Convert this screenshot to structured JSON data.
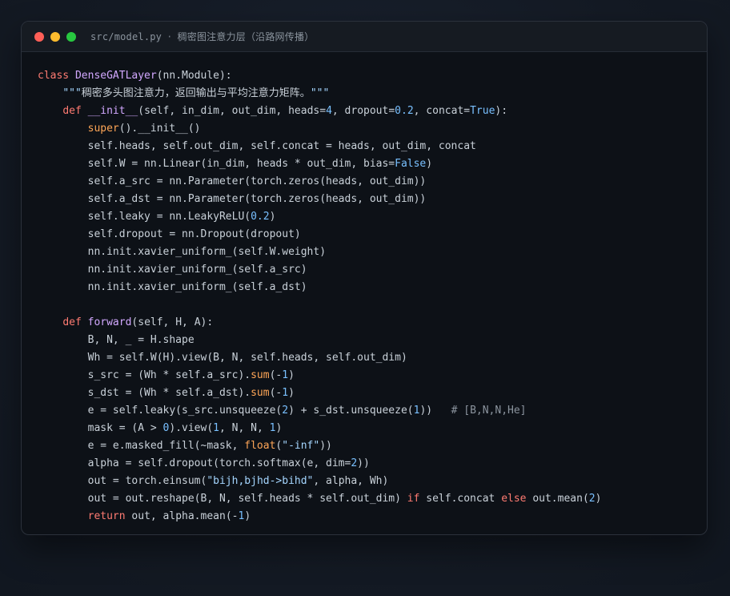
{
  "window": {
    "title_path": "src/model.py",
    "title_separator": "·",
    "title_desc": "稠密图注意力层（沿路网传播）"
  },
  "code": {
    "language": "python",
    "lines": [
      [
        [
          "kw",
          "class "
        ],
        [
          "fn",
          "DenseGATLayer"
        ],
        [
          "p",
          "(nn.Module):"
        ]
      ],
      [
        [
          "p",
          "    "
        ],
        [
          "doc",
          "\"\"\""
        ],
        [
          "p",
          "稠密多头图注意力，返回输出与平均注意力矩阵。"
        ],
        [
          "doc",
          "\"\"\""
        ]
      ],
      [
        [
          "p",
          "    "
        ],
        [
          "kw",
          "def "
        ],
        [
          "fn",
          "__init__"
        ],
        [
          "p",
          "(self, in_dim, out_dim, heads="
        ],
        [
          "num",
          "4"
        ],
        [
          "p",
          ", dropout="
        ],
        [
          "num",
          "0.2"
        ],
        [
          "p",
          ", concat="
        ],
        [
          "const",
          "True"
        ],
        [
          "p",
          "):"
        ]
      ],
      [
        [
          "p",
          "        "
        ],
        [
          "builtin",
          "super"
        ],
        [
          "p",
          "().__init__()"
        ]
      ],
      [
        [
          "p",
          "        self.heads, self.out_dim, self.concat = heads, out_dim, concat"
        ]
      ],
      [
        [
          "p",
          "        self.W = nn.Linear(in_dim, heads * out_dim, bias="
        ],
        [
          "const",
          "False"
        ],
        [
          "p",
          ")"
        ]
      ],
      [
        [
          "p",
          "        self.a_src = nn.Parameter(torch.zeros(heads, out_dim))"
        ]
      ],
      [
        [
          "p",
          "        self.a_dst = nn.Parameter(torch.zeros(heads, out_dim))"
        ]
      ],
      [
        [
          "p",
          "        self.leaky = nn.LeakyReLU("
        ],
        [
          "num",
          "0.2"
        ],
        [
          "p",
          ")"
        ]
      ],
      [
        [
          "p",
          "        self.dropout = nn.Dropout(dropout)"
        ]
      ],
      [
        [
          "p",
          "        nn.init.xavier_uniform_(self.W.weight)"
        ]
      ],
      [
        [
          "p",
          "        nn.init.xavier_uniform_(self.a_src)"
        ]
      ],
      [
        [
          "p",
          "        nn.init.xavier_uniform_(self.a_dst)"
        ]
      ],
      [
        [
          "p",
          ""
        ]
      ],
      [
        [
          "p",
          "    "
        ],
        [
          "kw",
          "def "
        ],
        [
          "fn",
          "forward"
        ],
        [
          "p",
          "(self, H, A):"
        ]
      ],
      [
        [
          "p",
          "        B, N, _ = H.shape"
        ]
      ],
      [
        [
          "p",
          "        Wh = self.W(H).view(B, N, self.heads, self.out_dim)"
        ]
      ],
      [
        [
          "p",
          "        s_src = (Wh * self.a_src)."
        ],
        [
          "builtin",
          "sum"
        ],
        [
          "p",
          "(-"
        ],
        [
          "num",
          "1"
        ],
        [
          "p",
          ")"
        ]
      ],
      [
        [
          "p",
          "        s_dst = (Wh * self.a_dst)."
        ],
        [
          "builtin",
          "sum"
        ],
        [
          "p",
          "(-"
        ],
        [
          "num",
          "1"
        ],
        [
          "p",
          ")"
        ]
      ],
      [
        [
          "p",
          "        e = self.leaky(s_src.unsqueeze("
        ],
        [
          "num",
          "2"
        ],
        [
          "p",
          ") + s_dst.unsqueeze("
        ],
        [
          "num",
          "1"
        ],
        [
          "p",
          "))   "
        ],
        [
          "com",
          "# [B,N,N,He]"
        ]
      ],
      [
        [
          "p",
          "        mask = (A > "
        ],
        [
          "num",
          "0"
        ],
        [
          "p",
          ").view("
        ],
        [
          "num",
          "1"
        ],
        [
          "p",
          ", N, N, "
        ],
        [
          "num",
          "1"
        ],
        [
          "p",
          ")"
        ]
      ],
      [
        [
          "p",
          "        e = e.masked_fill(~mask, "
        ],
        [
          "builtin",
          "float"
        ],
        [
          "p",
          "("
        ],
        [
          "str",
          "\"-inf\""
        ],
        [
          "p",
          "))"
        ]
      ],
      [
        [
          "p",
          "        alpha = self.dropout(torch.softmax(e, dim="
        ],
        [
          "num",
          "2"
        ],
        [
          "p",
          "))"
        ]
      ],
      [
        [
          "p",
          "        out = torch.einsum("
        ],
        [
          "str",
          "\"bijh,bjhd->bihd\""
        ],
        [
          "p",
          ", alpha, Wh)"
        ]
      ],
      [
        [
          "p",
          "        out = out.reshape(B, N, self.heads * self.out_dim) "
        ],
        [
          "kw",
          "if"
        ],
        [
          "p",
          " self.concat "
        ],
        [
          "kw",
          "else"
        ],
        [
          "p",
          " out.mean("
        ],
        [
          "num",
          "2"
        ],
        [
          "p",
          ")"
        ]
      ],
      [
        [
          "p",
          "        "
        ],
        [
          "kw",
          "return"
        ],
        [
          "p",
          " out, alpha.mean(-"
        ],
        [
          "num",
          "1"
        ],
        [
          "p",
          ")"
        ]
      ]
    ]
  },
  "colors": {
    "keyword": "#ff7b72",
    "function": "#d2a8ff",
    "builtin": "#ffa657",
    "number": "#79c0ff",
    "string": "#a5d6ff",
    "comment": "#8b949e",
    "text": "#c9d1d9",
    "background": "#0d1117"
  }
}
